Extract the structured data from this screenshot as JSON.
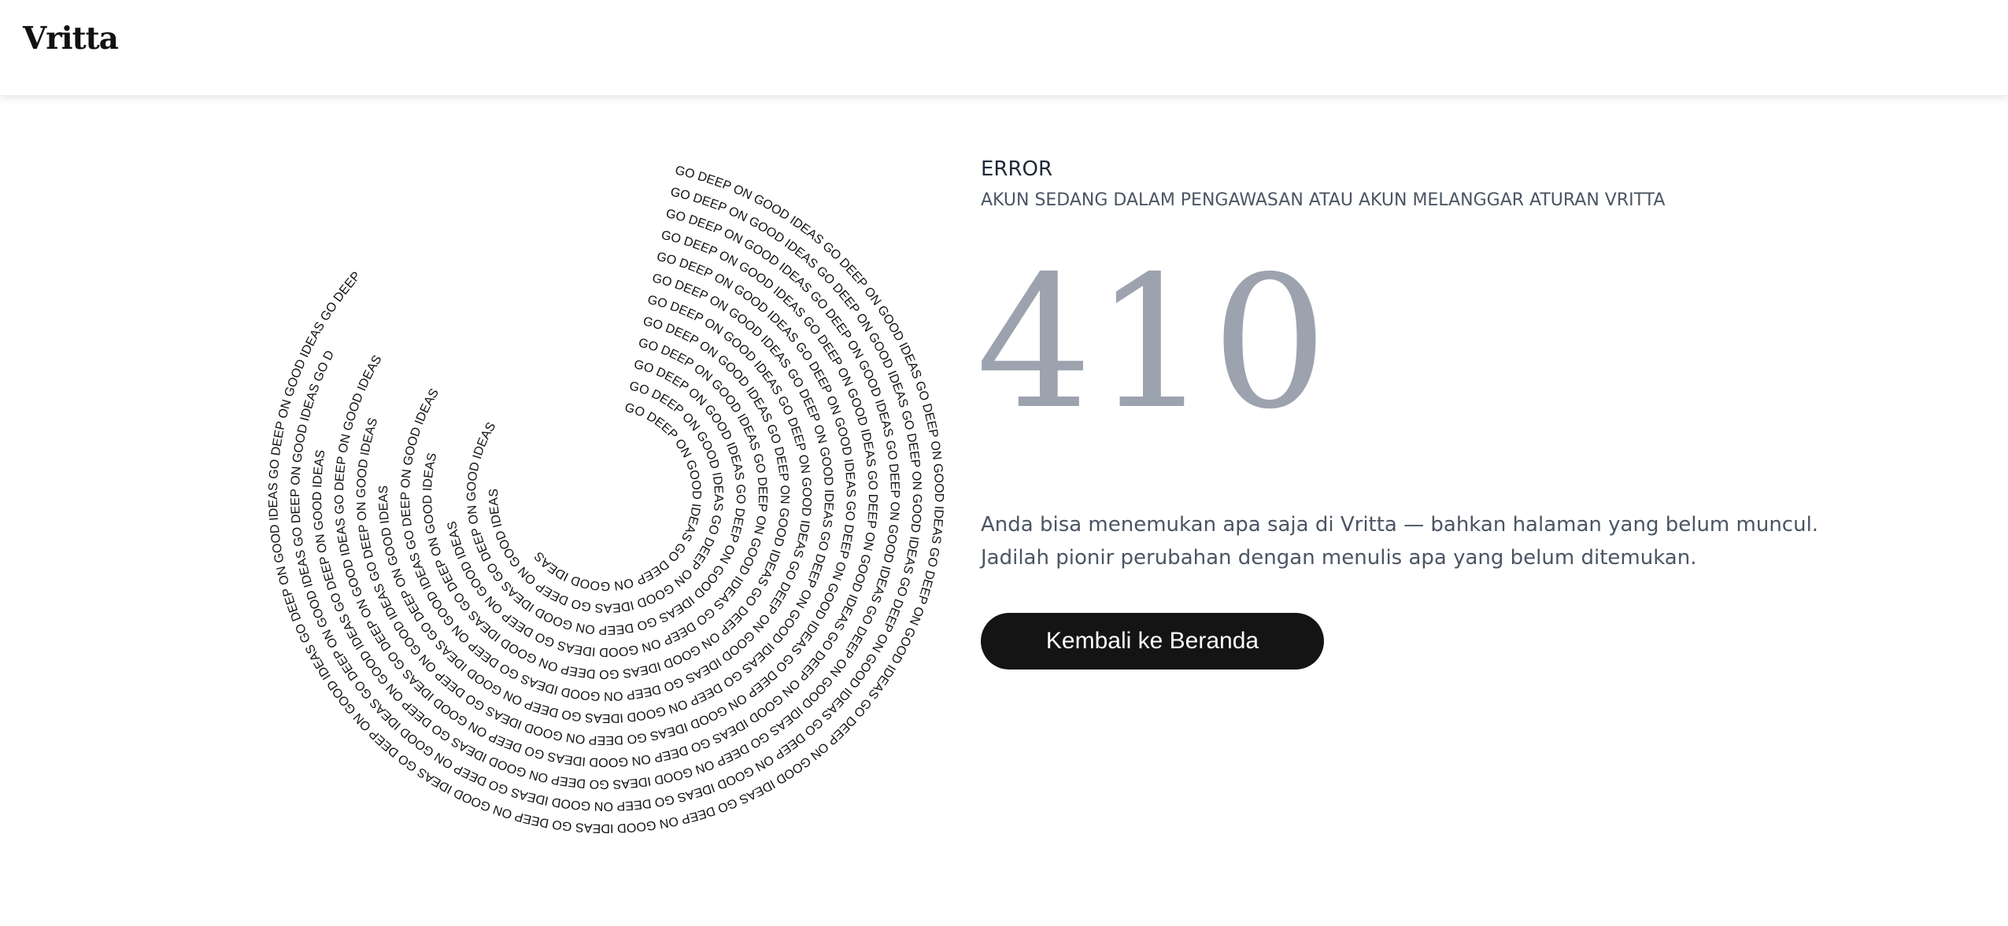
{
  "header": {
    "brand": "Vritta"
  },
  "illustration": {
    "phrase": "GO DEEP ON GOOD IDEAS",
    "text_color": "#111111"
  },
  "error": {
    "label": "ERROR",
    "subtitle": "AKUN SEDANG DALAM PENGAWASAN ATAU AKUN MELANGGAR ATURAN VRITTA",
    "code": "410",
    "message_line1": "Anda bisa menemukan apa saja di Vritta — bahkan halaman yang belum muncul.",
    "message_line2": "Jadilah pionir perubahan dengan menulis apa yang belum ditemukan."
  },
  "actions": {
    "home_button": "Kembali ke Beranda"
  },
  "colors": {
    "code_gray": "#9ca3af",
    "button_bg": "#141414",
    "button_text": "#ffffff",
    "muted_text": "#4b5563"
  }
}
